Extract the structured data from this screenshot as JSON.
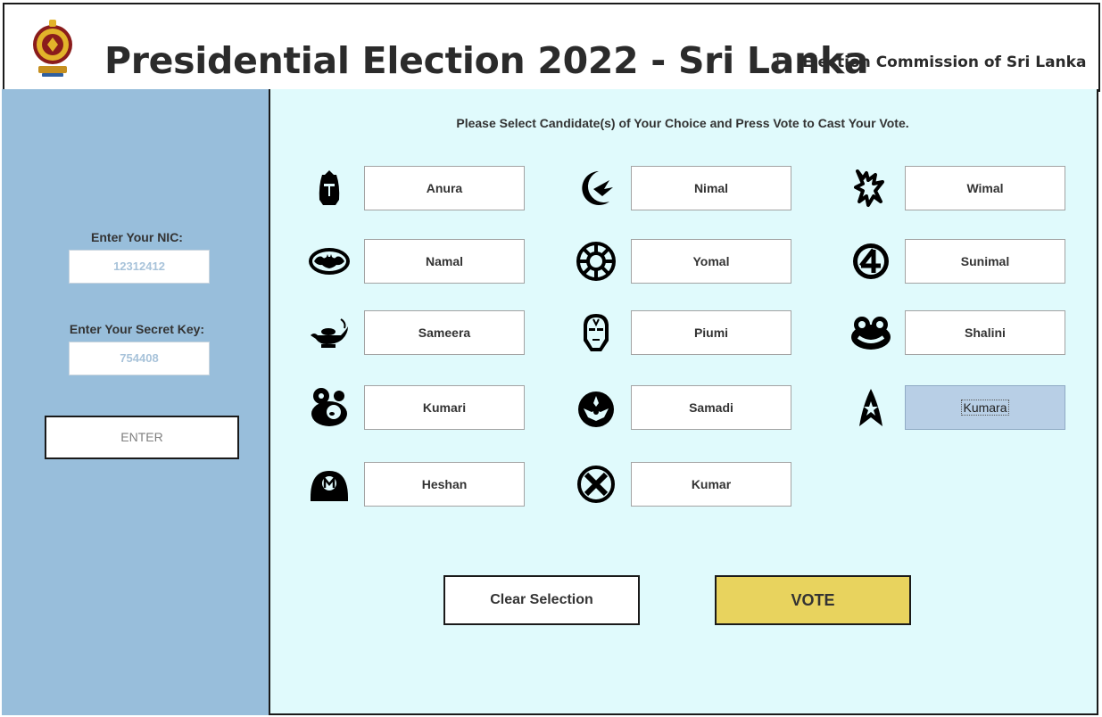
{
  "header": {
    "title": "Presidential Election 2022 - Sri Lanka",
    "separator": "|",
    "subtitle": "Election Commission of Sri Lanka",
    "emblem_icon": "sri-lanka-emblem-icon"
  },
  "sidebar": {
    "nic_label": "Enter Your NIC:",
    "nic_value": "12312412",
    "key_label": "Enter Your Secret Key:",
    "key_value": "754408",
    "enter_label": "ENTER"
  },
  "main": {
    "instruction": "Please Select Candidate(s) of Your Choice and Press Vote to Cast Your Vote.",
    "candidates": [
      {
        "name": "Anura",
        "icon": "helmet-icon"
      },
      {
        "name": "Nimal",
        "icon": "moon-bird-icon"
      },
      {
        "name": "Wimal",
        "icon": "tribal-deer-icon"
      },
      {
        "name": "Namal",
        "icon": "bat-logo-icon"
      },
      {
        "name": "Yomal",
        "icon": "sun-wheel-icon"
      },
      {
        "name": "Sunimal",
        "icon": "number-four-icon"
      },
      {
        "name": "Sameera",
        "icon": "magic-lamp-icon"
      },
      {
        "name": "Piumi",
        "icon": "iron-mask-icon"
      },
      {
        "name": "Shalini",
        "icon": "frog-face-icon"
      },
      {
        "name": "Kumari",
        "icon": "swirl-creature-icon"
      },
      {
        "name": "Samadi",
        "icon": "rebel-emblem-icon"
      },
      {
        "name": "Kumara",
        "icon": "star-badge-icon"
      },
      {
        "name": "Heshan",
        "icon": "m-cap-icon"
      },
      {
        "name": "Kumar",
        "icon": "x-circle-icon"
      }
    ],
    "selected_candidate": "Kumara",
    "clear_label": "Clear Selection",
    "vote_label": "VOTE"
  },
  "colors": {
    "sidebar_bg": "#98bedb",
    "main_bg": "#e0fafc",
    "vote_bg": "#e8d35e",
    "selected_bg": "#b8cfe6"
  }
}
